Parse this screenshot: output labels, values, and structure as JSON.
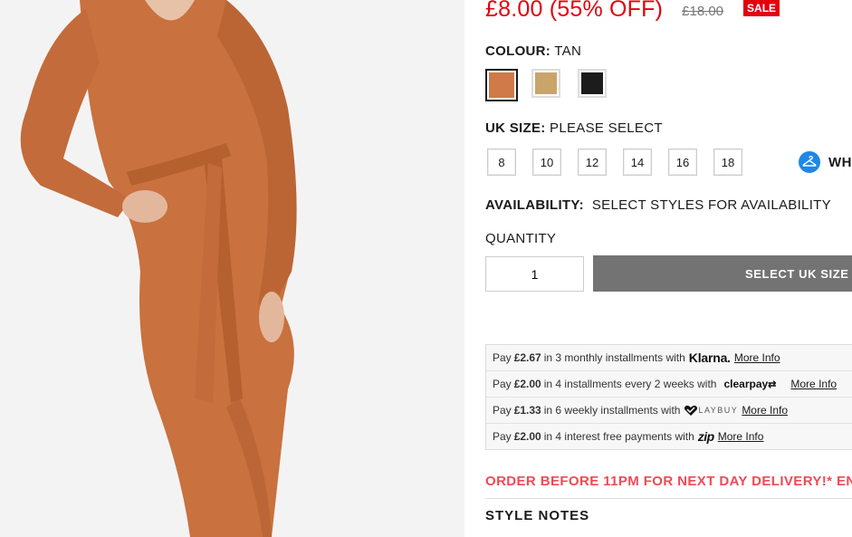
{
  "price": {
    "sale": "£8.00 (55% OFF)",
    "was": "£18.00",
    "badge": "SALE"
  },
  "colour": {
    "label": "COLOUR:",
    "value": "TAN",
    "swatches": [
      {
        "name": "tan",
        "color": "#cf7a48",
        "selected": true
      },
      {
        "name": "camel",
        "color": "#c9a56b",
        "selected": false
      },
      {
        "name": "black",
        "color": "#1c1c1c",
        "selected": false
      }
    ]
  },
  "size": {
    "label": "UK SIZE:",
    "value": "PLEASE SELECT",
    "options": [
      "8",
      "10",
      "12",
      "14",
      "16",
      "18"
    ],
    "guide_label": "WH"
  },
  "availability": {
    "label": "AVAILABILITY:",
    "value": "SELECT STYLES FOR AVAILABILITY"
  },
  "quantity": {
    "label": "QUANTITY",
    "value": "1"
  },
  "add_button": {
    "label": "SELECT UK SIZE"
  },
  "payments": [
    {
      "prefix": "Pay",
      "amount": "£2.67",
      "text": "in 3 monthly installments with",
      "provider": "Klarna.",
      "more": "More Info"
    },
    {
      "prefix": "Pay",
      "amount": "£2.00",
      "text": "in 4 installments every 2 weeks with",
      "provider": "clearpay",
      "more": "More Info"
    },
    {
      "prefix": "Pay",
      "amount": "£1.33",
      "text": "in 6 weekly installments with",
      "provider": "LAYBUY",
      "more": "More Info"
    },
    {
      "prefix": "Pay",
      "amount": "£2.00",
      "text": "in 4 interest free payments with",
      "provider": "zip",
      "more": "More Info"
    }
  ],
  "delivery_notice": "ORDER BEFORE 11PM FOR NEXT DAY DELIVERY!* EN",
  "style_notes": "STYLE NOTES",
  "colors": {
    "sale_red": "#e3000f",
    "notice_red": "#f04a55",
    "button_grey": "#737373",
    "size_guide_blue": "#1e88e5",
    "dress": "#c9713f"
  }
}
